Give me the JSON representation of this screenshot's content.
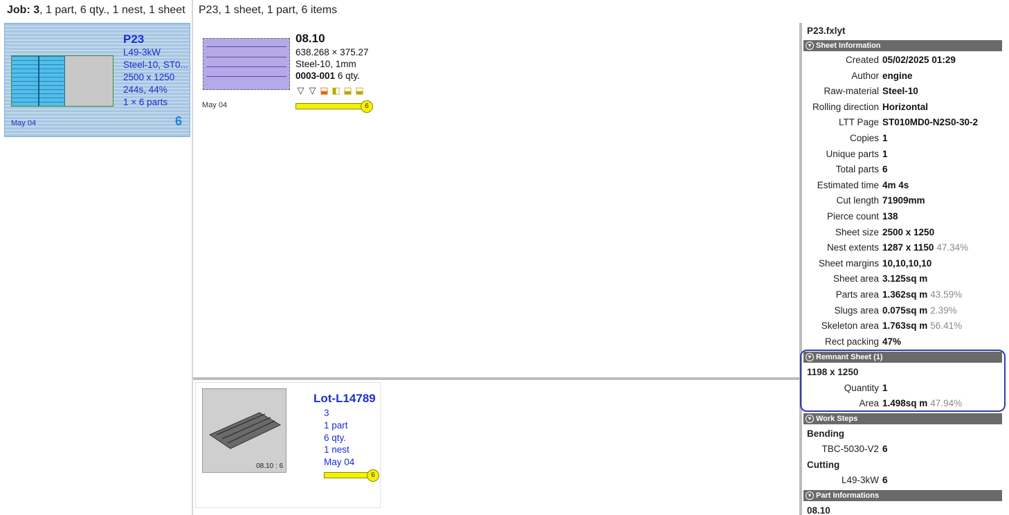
{
  "job_header": {
    "label": "Job:",
    "number": "3",
    "rest": ", 1 part, 6 qty., 1 nest, 1 sheet"
  },
  "sheet_card": {
    "title": "P23",
    "lines": [
      "L49-3kW",
      "Steel-10, ST0...",
      "2500 x 1250",
      "244s, 44%",
      "1 × 6 parts"
    ],
    "date": "May 04",
    "count": "6"
  },
  "mid_header": "P23, 1 sheet, 1 part, 6 items",
  "part": {
    "title": "08.10",
    "dims": "638.268 × 375.27",
    "material": "Steel-10, 1mm",
    "id": "0003-001",
    "qty": "6 qty.",
    "date": "May 04",
    "progress_value": "6",
    "progress_fraction": 1.0,
    "icons": [
      "cut-icon",
      "cut-icon",
      "bend-orange-icon",
      "bend-left-icon",
      "bend-down-icon",
      "bend-down-icon"
    ]
  },
  "lot": {
    "title": "Lot-L14789",
    "lines": [
      "3",
      "1 part",
      "6 qty.",
      "1 nest",
      "May 04"
    ],
    "thumb_label": "08.10 : 6",
    "progress_value": "6",
    "progress_fraction": 1.0
  },
  "right": {
    "filename": "P23.fxlyt",
    "sections": {
      "sheet_info": "Sheet Information",
      "remnant": "Remnant Sheet (1)",
      "work_steps": "Work Steps",
      "part_info": "Part Informations"
    },
    "sheet_info": [
      {
        "k": "Created",
        "v": "05/02/2025 01:29",
        "pct": ""
      },
      {
        "k": "Author",
        "v": "engine",
        "pct": ""
      },
      {
        "k": "Raw-material",
        "v": "Steel-10",
        "pct": ""
      },
      {
        "k": "Rolling direction",
        "v": "Horizontal",
        "pct": ""
      },
      {
        "k": "LTT Page",
        "v": "ST010MD0-N2S0-30-2",
        "pct": ""
      },
      {
        "k": "Copies",
        "v": "1",
        "pct": ""
      },
      {
        "k": "Unique parts",
        "v": "1",
        "pct": ""
      },
      {
        "k": "Total parts",
        "v": "6",
        "pct": ""
      },
      {
        "k": "Estimated time",
        "v": "4m 4s",
        "pct": ""
      },
      {
        "k": "Cut length",
        "v": "71909mm",
        "pct": ""
      },
      {
        "k": "Pierce count",
        "v": "138",
        "pct": ""
      },
      {
        "k": "Sheet size",
        "v": "2500 x 1250",
        "pct": ""
      },
      {
        "k": "Nest extents",
        "v": "1287 x 1150",
        "pct": "47.34%"
      },
      {
        "k": "Sheet margins",
        "v": "10,10,10,10",
        "pct": ""
      },
      {
        "k": "Sheet area",
        "v": "3.125sq m",
        "pct": ""
      },
      {
        "k": "Parts area",
        "v": "1.362sq m",
        "pct": "43.59%"
      },
      {
        "k": "Slugs area",
        "v": "0.075sq m",
        "pct": "2.39%"
      },
      {
        "k": "Skeleton area",
        "v": "1.763sq m",
        "pct": "56.41%"
      },
      {
        "k": "Rect packing",
        "v": "47%",
        "pct": ""
      }
    ],
    "remnant": {
      "size": "1198 x 1250",
      "rows": [
        {
          "k": "Quantity",
          "v": "1",
          "pct": ""
        },
        {
          "k": "Area",
          "v": "1.498sq m",
          "pct": "47.94%"
        }
      ]
    },
    "work_steps": {
      "bending_label": "Bending",
      "bending_row": {
        "k": "TBC-5030-V2",
        "v": "6"
      },
      "cutting_label": "Cutting",
      "cutting_row": {
        "k": "L49-3kW",
        "v": "6"
      }
    },
    "part_info_first": "08.10"
  }
}
